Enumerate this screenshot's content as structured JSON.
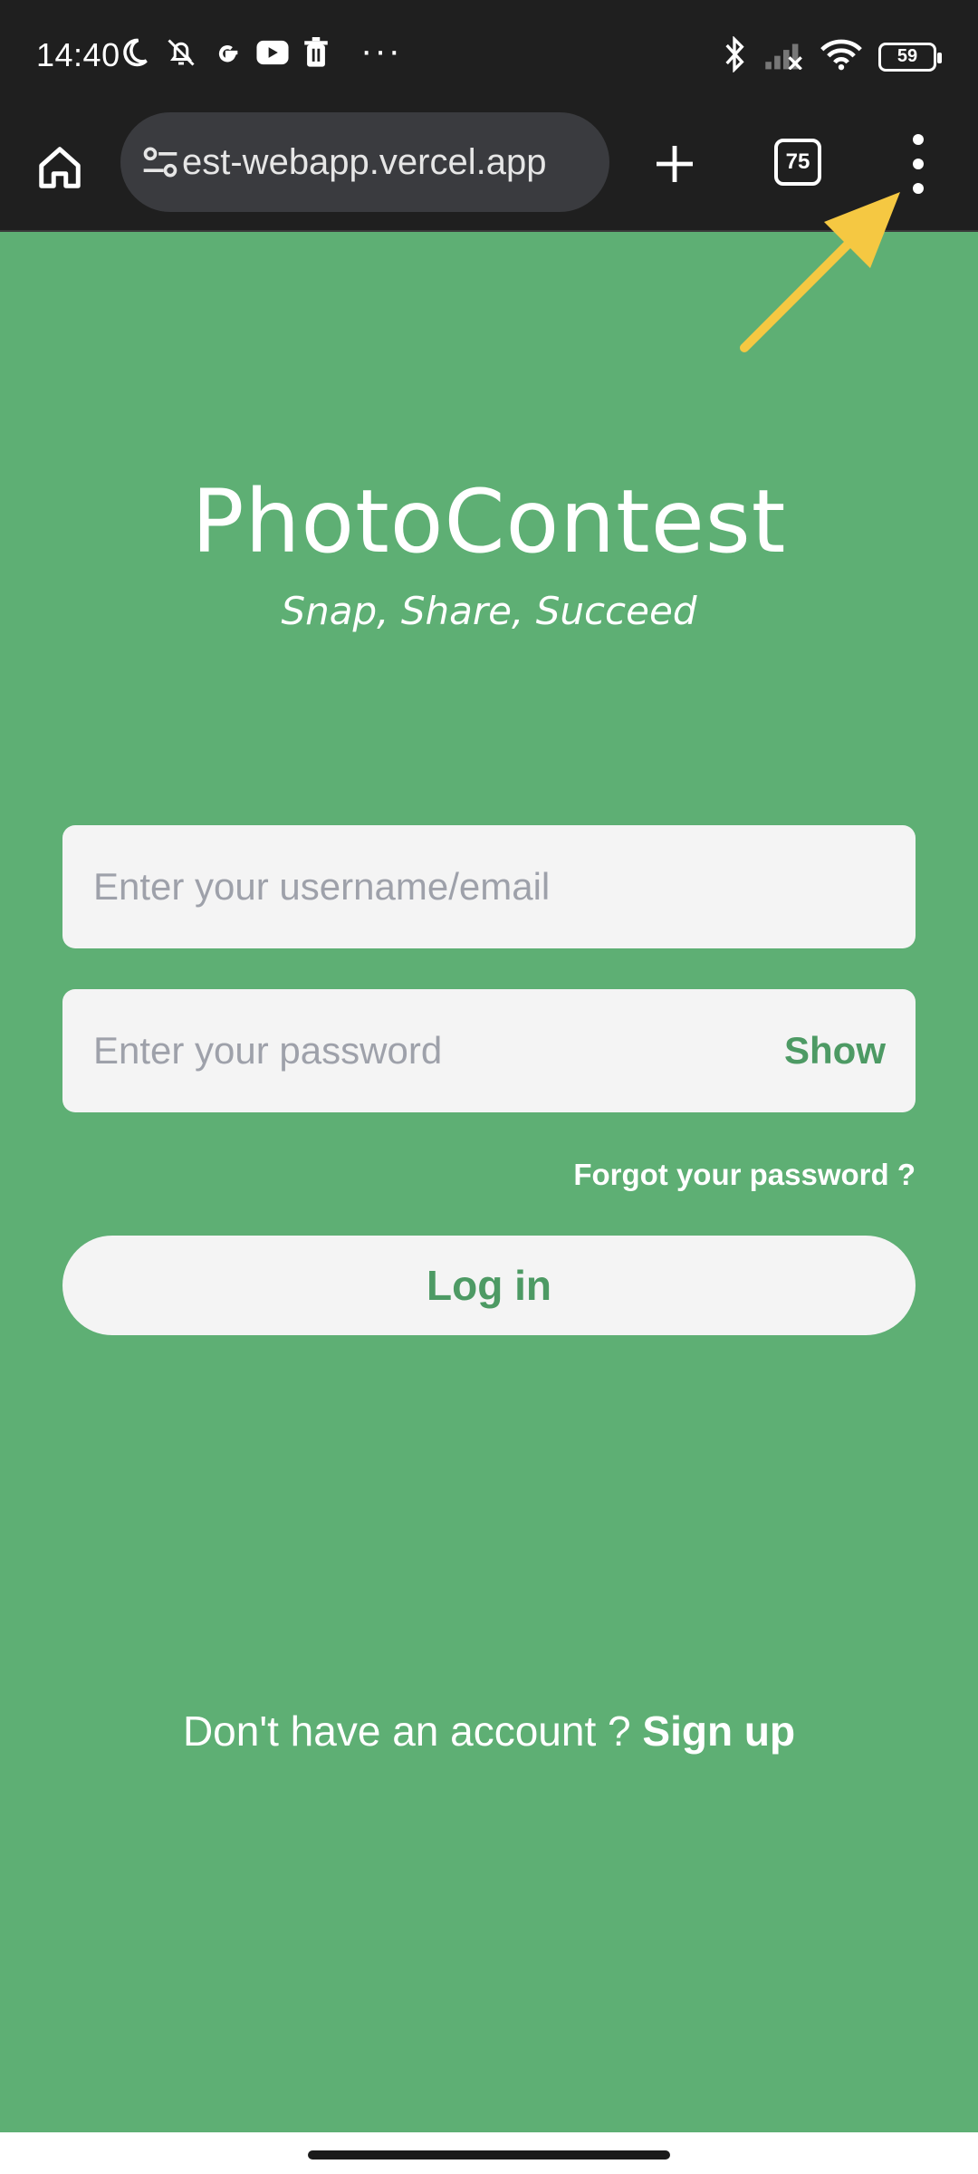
{
  "status_bar": {
    "time": "14:40",
    "battery_level": "59",
    "overflow_indicator": "···",
    "icons": [
      "moon-icon",
      "bell-off-icon",
      "google-icon",
      "youtube-icon",
      "trash-icon",
      "bluetooth-icon",
      "signal-icon",
      "wifi-icon",
      "battery-icon"
    ]
  },
  "browser": {
    "url_text": "est-webapp.vercel.app",
    "tab_count": "75",
    "icons": [
      "home-icon",
      "site-settings-icon",
      "plus-icon",
      "tabs-icon",
      "more-vert-icon"
    ]
  },
  "app": {
    "title": "PhotoContest",
    "tagline": "Snap, Share, Succeed"
  },
  "login_form": {
    "username_placeholder": "Enter your username/email",
    "username_value": "",
    "password_placeholder": "Enter your password",
    "password_value": "",
    "show_label": "Show",
    "forgot_label": "Forgot your password ?",
    "login_label": "Log in"
  },
  "signup": {
    "prompt": "Don't have an account ? ",
    "link_label": "Sign up"
  },
  "colors": {
    "background": "#5eaf74",
    "accent_green": "#4d9a64",
    "field_background": "#f4f4f4",
    "annotation_arrow": "#f5c842",
    "toolbar": "#1f1f1f"
  }
}
